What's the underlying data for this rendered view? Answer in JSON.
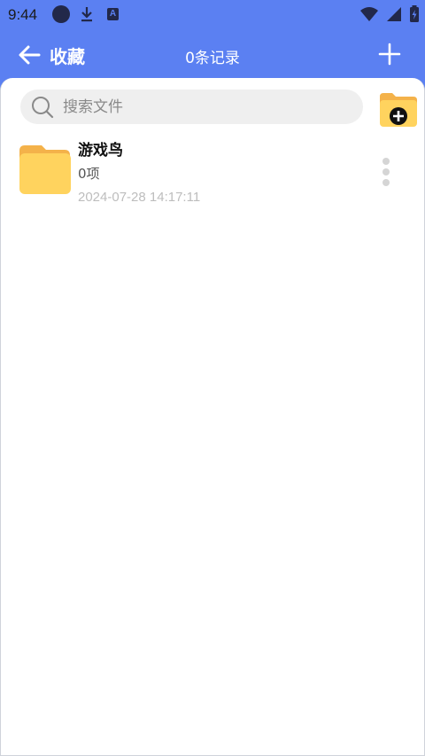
{
  "status_bar": {
    "time": "9:44",
    "icons": [
      "circle-icon",
      "download-icon",
      "translate-icon",
      "wifi-icon",
      "signal-icon",
      "battery-charging-icon"
    ],
    "badge_text": "A"
  },
  "appbar": {
    "title": "收藏",
    "record_count": "0条记录",
    "background": "#5b80f2",
    "icons": {
      "back": "arrow-left-icon",
      "add": "plus-icon"
    }
  },
  "search": {
    "placeholder": "搜索文件",
    "value": ""
  },
  "new_folder": {
    "icon": "folder-add-icon"
  },
  "list": [
    {
      "name": "游戏鸟",
      "count": "0项",
      "date": "2024-07-28 14:17:11",
      "icon": "folder-icon",
      "menu_icon": "more-vertical-icon"
    }
  ],
  "colors": {
    "accent": "#5b80f2",
    "folder": "#ffd35e",
    "folder_tab": "#f4b24a"
  }
}
